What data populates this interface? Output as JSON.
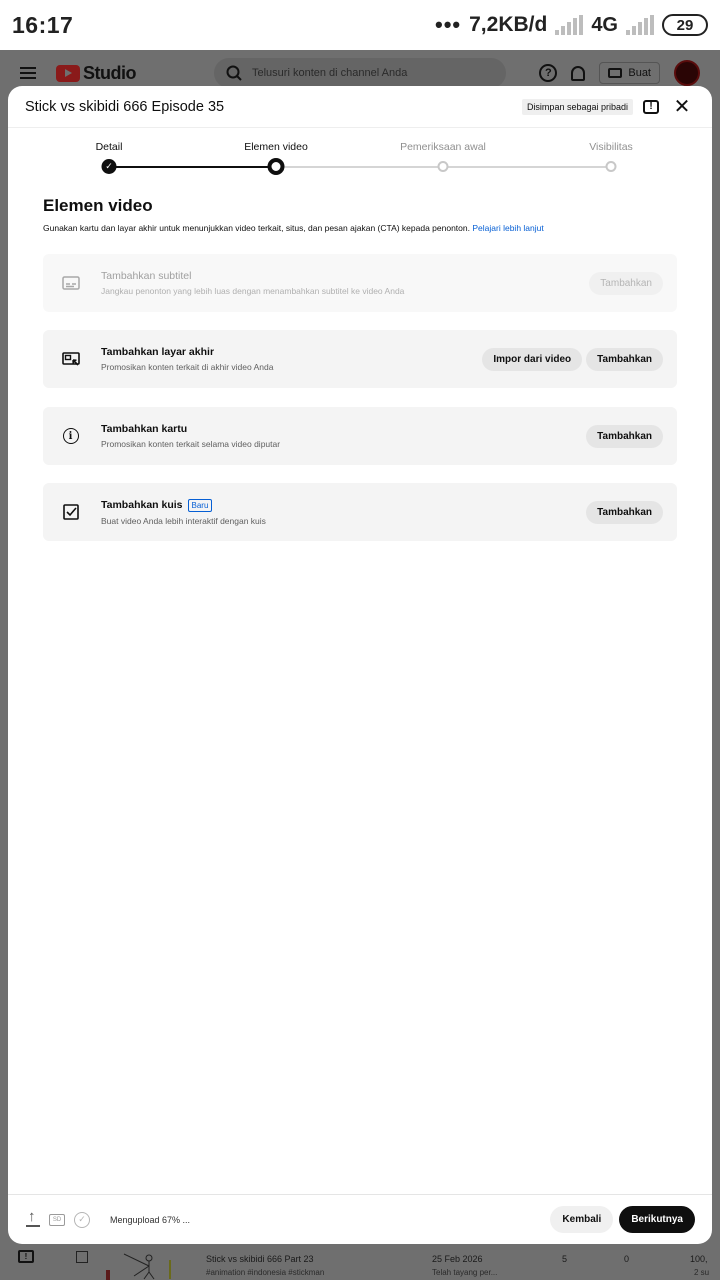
{
  "status_bar": {
    "time": "16:17",
    "dots": "•••",
    "speed": "7,2KB/d",
    "network": "4G",
    "battery": "29"
  },
  "background": {
    "brand": "Studio",
    "search_placeholder": "Telusuri konten di channel Anda",
    "help_icon": "?",
    "create_label": "Buat",
    "row": {
      "title": "Stick vs skibidi 666 Part 23",
      "tags": "#animation #indonesia #stickman",
      "date": "25 Feb 2026",
      "date_sub": "Telah tayang per...",
      "views": "5",
      "comments": "0",
      "likes": "100,",
      "likes_sub": "2 su"
    },
    "colors": {
      "brand_red": "#8a1a1a",
      "dim": "#6f6f6f"
    }
  },
  "modal": {
    "title": "Stick vs skibidi 666 Episode 35",
    "saved_badge": "Disimpan sebagai pribadi",
    "feedback_icon": "!",
    "close_icon": "✕",
    "steps": [
      {
        "label": "Detail",
        "state": "done",
        "check": "✓"
      },
      {
        "label": "Elemen video",
        "state": "current"
      },
      {
        "label": "Pemeriksaan awal",
        "state": "todo"
      },
      {
        "label": "Visibilitas",
        "state": "todo"
      }
    ],
    "section": {
      "title": "Elemen video",
      "description": "Gunakan kartu dan layar akhir untuk menunjukkan video terkait, situs, dan pesan ajakan (CTA) kepada penonton.",
      "link": "Pelajari lebih lanjut"
    },
    "cards": [
      {
        "icon": "subtitles-icon",
        "title": "Tambahkan subtitel",
        "subtitle": "Jangkau penonton yang lebih luas dengan menambahkan subtitel ke video Anda",
        "add_label": "Tambahkan",
        "disabled": true
      },
      {
        "icon": "end-screen-icon",
        "title": "Tambahkan layar akhir",
        "subtitle": "Promosikan konten terkait di akhir video Anda",
        "import_label": "Impor dari video",
        "add_label": "Tambahkan"
      },
      {
        "icon": "info-icon",
        "title": "Tambahkan kartu",
        "subtitle": "Promosikan konten terkait selama video diputar",
        "add_label": "Tambahkan",
        "info_glyph": "i"
      },
      {
        "icon": "checkbox-icon",
        "title": "Tambahkan kuis",
        "badge": "Baru",
        "subtitle": "Buat video Anda lebih interaktif dengan kuis",
        "add_label": "Tambahkan"
      }
    ],
    "footer": {
      "sd_label": "SD",
      "check_glyph": "✓",
      "status": "Mengupload 67% ...",
      "back_label": "Kembali",
      "next_label": "Berikutnya"
    }
  }
}
